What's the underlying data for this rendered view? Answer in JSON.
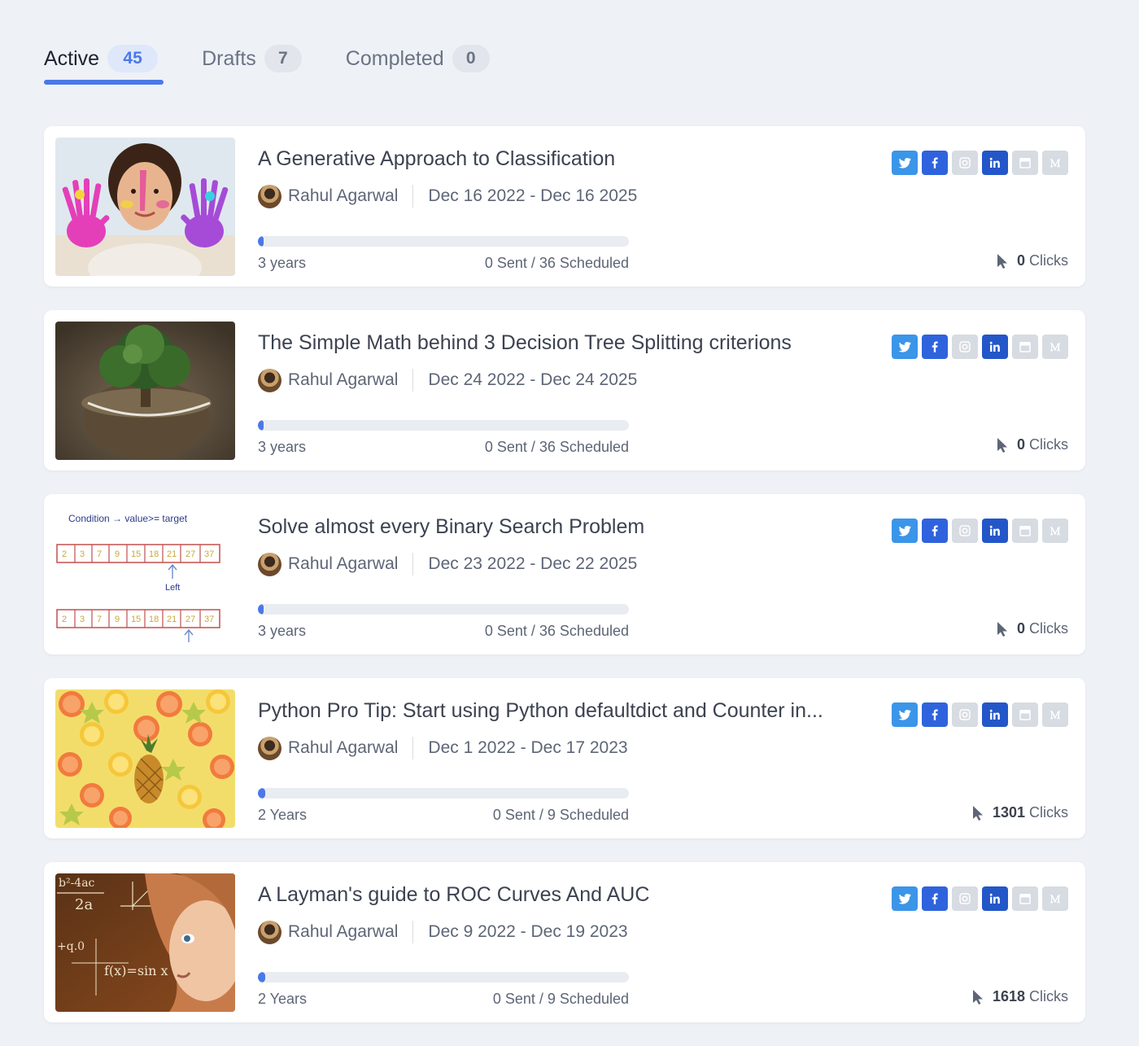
{
  "tabs": [
    {
      "label": "Active",
      "count": "45"
    },
    {
      "label": "Drafts",
      "count": "7"
    },
    {
      "label": "Completed",
      "count": "0"
    }
  ],
  "colors": {
    "accent": "#4a78e8",
    "twitter": "#3b95e8",
    "facebook": "#2f63dd",
    "linkedin": "#2356c8",
    "disabled": "#d7dbe2"
  },
  "campaigns": [
    {
      "title": "A Generative Approach to Classification",
      "author": "Rahul Agarwal",
      "dates": "Dec 16 2022 - Dec 16 2025",
      "duration": "3 years",
      "sent": "0 Sent / 36 Scheduled",
      "progress_fraction": 0.01,
      "clicks": "0",
      "clicks_label": "Clicks",
      "image": "child-painted-hands-photo"
    },
    {
      "title": "The Simple Math behind 3 Decision Tree Splitting criterions",
      "author": "Rahul Agarwal",
      "dates": "Dec 24 2022 - Dec 24 2025",
      "duration": "3 years",
      "sent": "0 Sent / 36 Scheduled",
      "progress_fraction": 0.01,
      "clicks": "0",
      "clicks_label": "Clicks",
      "image": "tree-on-soil-globe-photo"
    },
    {
      "title": "Solve almost every Binary Search Problem",
      "author": "Rahul Agarwal",
      "dates": "Dec 23 2022 - Dec 22 2025",
      "duration": "3 years",
      "sent": "0 Sent / 36 Scheduled",
      "progress_fraction": 0.01,
      "clicks": "0",
      "clicks_label": "Clicks",
      "image": "binary-search-sketch"
    },
    {
      "title": "Python Pro Tip: Start using Python defaultdict and Counter in...",
      "author": "Rahul Agarwal",
      "dates": "Dec 1 2022 - Dec 17 2023",
      "duration": "2 Years",
      "sent": "0 Sent / 9 Scheduled",
      "progress_fraction": 0.02,
      "clicks": "1301",
      "clicks_label": "Clicks",
      "image": "citrus-and-pineapple-photo"
    },
    {
      "title": "A Layman's guide to ROC Curves And AUC",
      "author": "Rahul Agarwal",
      "dates": "Dec 9 2022 - Dec 19 2023",
      "duration": "2 Years",
      "sent": "0 Sent / 9 Scheduled",
      "progress_fraction": 0.02,
      "clicks": "1618",
      "clicks_label": "Clicks",
      "image": "child-with-math-formulas-photo"
    }
  ],
  "binary_search_sketch": {
    "condition": "Condition → value>= target",
    "cells": [
      "2",
      "3",
      "7",
      "9",
      "15",
      "18",
      "21",
      "27",
      "37"
    ],
    "pointer_label": "Left"
  },
  "roc_image_formulas": [
    "b²-4ac",
    "2a",
    "f(x)=sin x",
    "+q.0"
  ]
}
